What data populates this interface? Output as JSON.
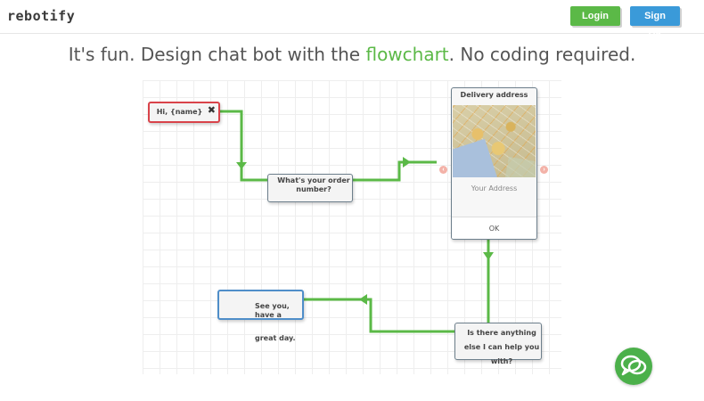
{
  "header": {
    "logo": "rebotify",
    "login_label": "Login",
    "signup_label": "Sign Up"
  },
  "headline": {
    "before": "It's fun. Design chat bot with the ",
    "highlight": "flowchart",
    "after": ". No coding required."
  },
  "flow": {
    "start_node": "Hi, {name}",
    "start_close": "✖",
    "order_node": "What's your order number?",
    "order_line1": "What's your order",
    "order_line2": "number?",
    "delivery_card": {
      "title": "Delivery address",
      "address_placeholder": "Your Address",
      "ok_label": "OK"
    },
    "anything_line1": "Is there anything",
    "anything_line2": "else I can help you",
    "anything_line3": "with?",
    "end_line1": "See you, have a",
    "end_line2": "great day."
  },
  "icons": {
    "chat": "chat-bubble-icon",
    "prev": "chevron-left-icon",
    "next": "chevron-right-icon"
  },
  "colors": {
    "green": "#5bb947",
    "login": "#5bb947",
    "signup": "#3a9ad9",
    "wire": "#5bb947",
    "start_border": "#d9434a",
    "end_border": "#4f8ec9"
  }
}
